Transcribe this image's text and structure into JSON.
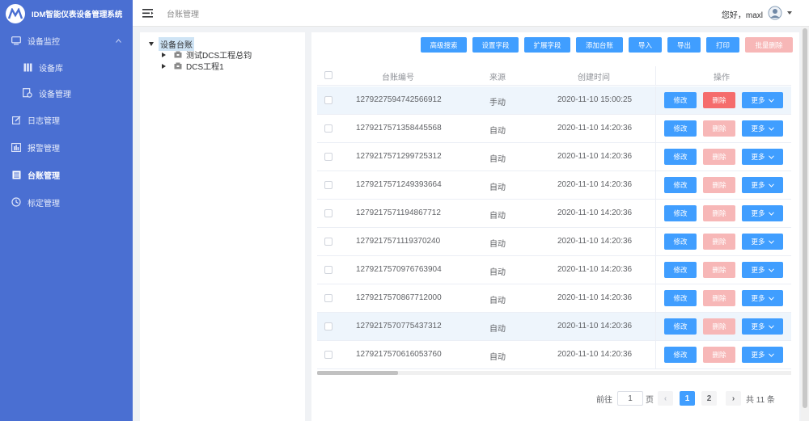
{
  "app": {
    "title": "IDM智能仪表设备管理系统"
  },
  "sidebar": {
    "items": [
      {
        "label": "设备监控",
        "icon": "monitor-icon"
      },
      {
        "label": "设备库",
        "icon": "library-icon"
      },
      {
        "label": "设备管理",
        "icon": "device-manage-icon"
      },
      {
        "label": "日志管理",
        "icon": "edit-icon"
      },
      {
        "label": "报警管理",
        "icon": "alarm-icon"
      },
      {
        "label": "台账管理",
        "icon": "ledger-icon"
      },
      {
        "label": "标定管理",
        "icon": "calibrate-icon"
      }
    ],
    "active": "台账管理"
  },
  "header": {
    "breadcrumb": "台账管理",
    "greeting": "您好，maxl"
  },
  "tree": {
    "root": "设备台账",
    "children": [
      "测试DCS工程总钧",
      "DCS工程1"
    ]
  },
  "toolbar": {
    "search": "高级搜索",
    "set_field": "设置字段",
    "ext_field": "扩展字段",
    "add": "添加台账",
    "import": "导入",
    "export": "导出",
    "print": "打印",
    "batch_delete": "批量删除"
  },
  "table": {
    "headers": {
      "id": "台账编号",
      "source": "来源",
      "created": "创建时间",
      "ops": "操作"
    },
    "actions": {
      "edit": "修改",
      "delete": "删除",
      "more": "更多"
    },
    "rows": [
      {
        "id": "1279227594742566912",
        "source": "手动",
        "created": "2020-11-10 15:00:25"
      },
      {
        "id": "1279217571358445568",
        "source": "自动",
        "created": "2020-11-10 14:20:36"
      },
      {
        "id": "1279217571299725312",
        "source": "自动",
        "created": "2020-11-10 14:20:36"
      },
      {
        "id": "1279217571249393664",
        "source": "自动",
        "created": "2020-11-10 14:20:36"
      },
      {
        "id": "1279217571194867712",
        "source": "自动",
        "created": "2020-11-10 14:20:36"
      },
      {
        "id": "1279217571119370240",
        "source": "自动",
        "created": "2020-11-10 14:20:36"
      },
      {
        "id": "1279217570976763904",
        "source": "自动",
        "created": "2020-11-10 14:20:36"
      },
      {
        "id": "1279217570867712000",
        "source": "自动",
        "created": "2020-11-10 14:20:36"
      },
      {
        "id": "1279217570775437312",
        "source": "自动",
        "created": "2020-11-10 14:20:36"
      },
      {
        "id": "1279217570616053760",
        "source": "自动",
        "created": "2020-11-10 14:20:36"
      }
    ]
  },
  "pagination": {
    "goto_label": "前往",
    "page_input": "1",
    "page_unit": "页",
    "pages": [
      "1",
      "2"
    ],
    "current": "1",
    "total": "共 11 条",
    "prev": "‹",
    "next": "›"
  },
  "colors": {
    "sidebar": "#4a6fd2",
    "primary": "#409eff",
    "danger": "#f56c6c",
    "danger_disabled": "#f7b7b7"
  }
}
